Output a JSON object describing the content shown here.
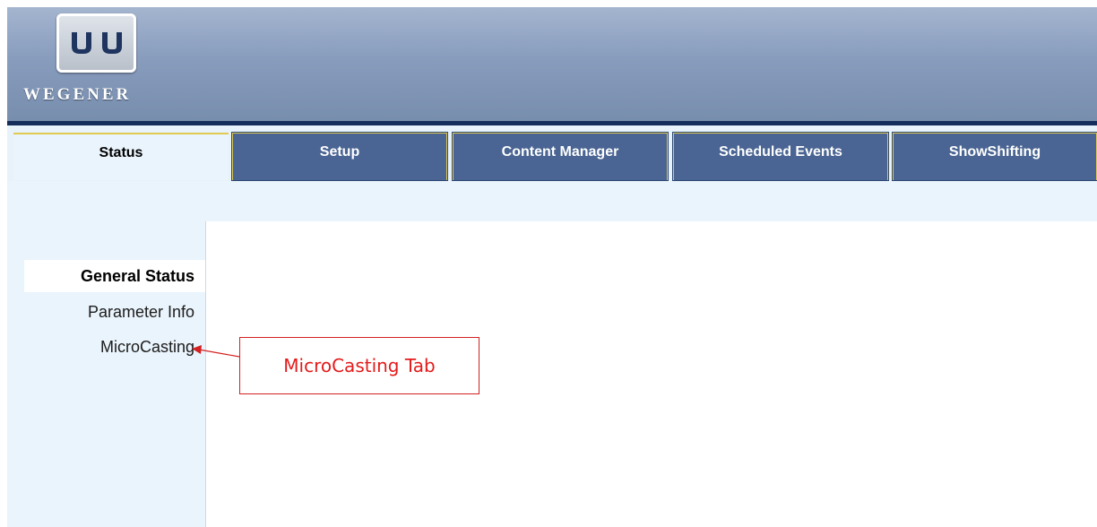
{
  "brand": {
    "name": "WEGENER",
    "colors": {
      "header": "#889cbd",
      "tab_inactive": "#4a6593",
      "tab_border": "#e2c94f",
      "panel_bg": "#eaf4fc",
      "callout": "#e41b1b"
    }
  },
  "tabs": [
    {
      "label": "Status",
      "active": true
    },
    {
      "label": "Setup",
      "active": false
    },
    {
      "label": "Content Manager",
      "active": false
    },
    {
      "label": "Scheduled Events",
      "active": false
    },
    {
      "label": "ShowShifting",
      "active": false
    }
  ],
  "sidebar": {
    "items": [
      {
        "label": "General Status",
        "active": true
      },
      {
        "label": "Parameter Info",
        "active": false
      },
      {
        "label": "MicroCasting",
        "active": false
      }
    ]
  },
  "annotation": {
    "label": "MicroCasting Tab",
    "icon": "arrow-left-icon"
  }
}
